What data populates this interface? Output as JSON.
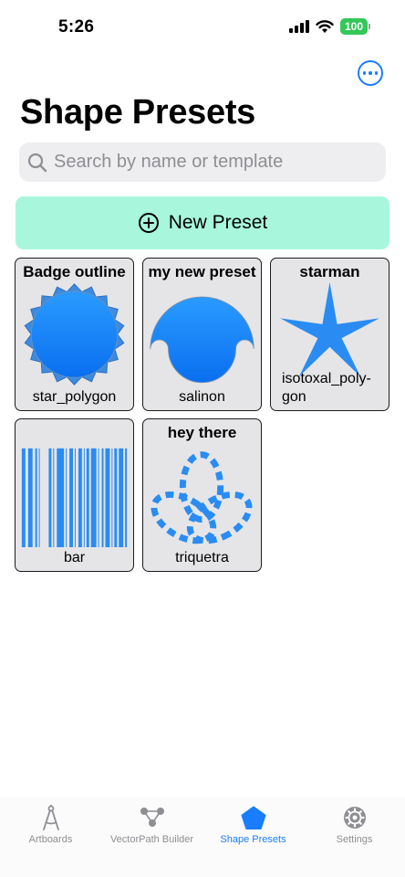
{
  "status": {
    "time": "5:26",
    "battery": "100"
  },
  "header": {
    "title": "Shape Presets",
    "more_icon": "ellipsis-circle-icon"
  },
  "search": {
    "placeholder": "Search by name or template"
  },
  "new_preset": {
    "label": "New Preset",
    "icon": "plus-circle-icon"
  },
  "presets": [
    {
      "name": "Badge outline",
      "template": "star_polygon"
    },
    {
      "name": "my new preset",
      "template": "salinon"
    },
    {
      "name": "starman",
      "template": "isotoxal_poly-gon"
    },
    {
      "name": "",
      "template": "bar"
    },
    {
      "name": "hey there",
      "template": "triquetra"
    }
  ],
  "tabs": [
    {
      "label": "Artboards",
      "icon": "compass-drafting-icon"
    },
    {
      "label": "VectorPath Builder",
      "icon": "vector-nodes-icon"
    },
    {
      "label": "Shape Presets",
      "icon": "pentagon-icon"
    },
    {
      "label": "Settings",
      "icon": "gear-icon"
    }
  ],
  "colors": {
    "accent": "#1a7dff",
    "shape_fill": "#1f8efb",
    "new_preset_bg": "#a8f7dd",
    "card_bg": "#e5e5e7"
  }
}
